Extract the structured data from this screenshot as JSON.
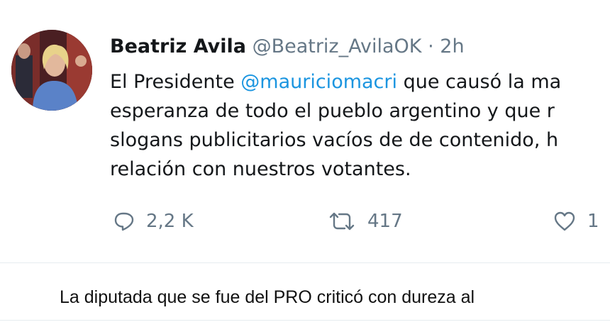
{
  "tweet": {
    "author_name": "Beatriz Avila",
    "author_handle": "@Beatriz_AvilaOK",
    "separator": "·",
    "age": "2h",
    "text": {
      "line1_before": "El Presidente ",
      "line1_mention": "@mauriciomacri",
      "line1_after": " que causó la ma",
      "line2": "esperanza de todo el pueblo argentino y que r",
      "line3": "slogans publicitarios vacíos de de contenido, h",
      "line4": "relación con nuestros votantes."
    },
    "actions": {
      "reply_count": "2,2 K",
      "retweet_count": "417",
      "like_count": "1"
    },
    "icons": {
      "reply": "reply-bubble-icon",
      "retweet": "retweet-icon",
      "like": "heart-icon"
    }
  },
  "caption": "La diputada que se fue del PRO criticó con dureza al",
  "colors": {
    "text_primary": "#14171a",
    "text_secondary": "#657786",
    "mention": "#1b95e0",
    "divider": "#e6ecf0"
  }
}
